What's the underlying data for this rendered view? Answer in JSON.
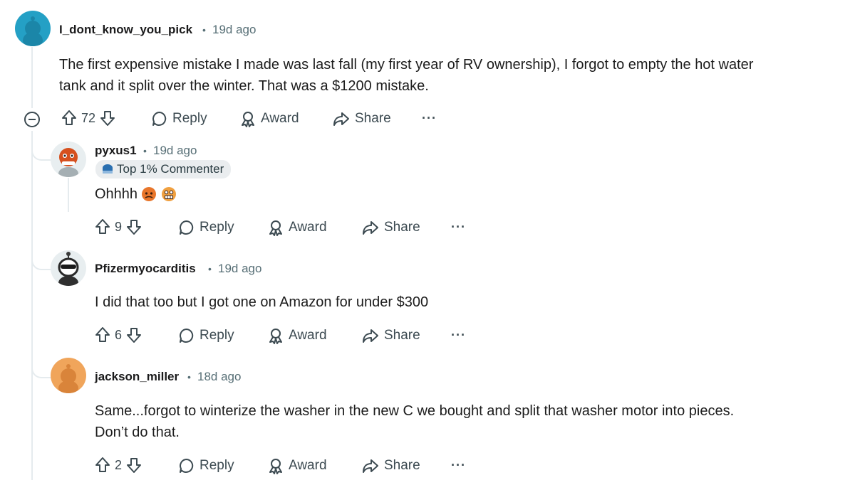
{
  "comments": [
    {
      "username": "I_dont_know_you_pick",
      "time": "19d ago",
      "text_line1": "The first expensive mistake I made was last fall (my first year of RV ownership), I forgot to empty the hot water",
      "text_line2": "tank and it split over the winter. That was a $1200 mistake.",
      "votes": "72",
      "avatar_color": "#24a0c5"
    },
    {
      "username": "pyxus1",
      "time": "19d ago",
      "badge": "Top 1% Commenter",
      "text": "Ohhhh",
      "votes": "9",
      "avatar_color": "#e8eef0"
    },
    {
      "username": "Pfizermyocarditis",
      "time": "19d ago",
      "text": "I did that too but I got one on Amazon for under $300",
      "votes": "6",
      "avatar_color": "#e8eef0"
    },
    {
      "username": "jackson_miller",
      "time": "18d ago",
      "text_line1": "Same...forgot to winterize the washer in the new C we bought and split that washer motor into pieces.",
      "text_line2": "Don’t do that.",
      "votes": "2",
      "avatar_color": "#f0a55b"
    }
  ],
  "actions": {
    "reply": "Reply",
    "award": "Award",
    "share": "Share",
    "more": "···"
  },
  "separator": "•",
  "icons": {
    "upvote": "arrow-up-icon",
    "downvote": "arrow-down-icon",
    "reply": "speech-bubble-icon",
    "award": "award-ribbon-icon",
    "share": "share-arrow-icon",
    "collapse": "minus-circle-icon"
  }
}
